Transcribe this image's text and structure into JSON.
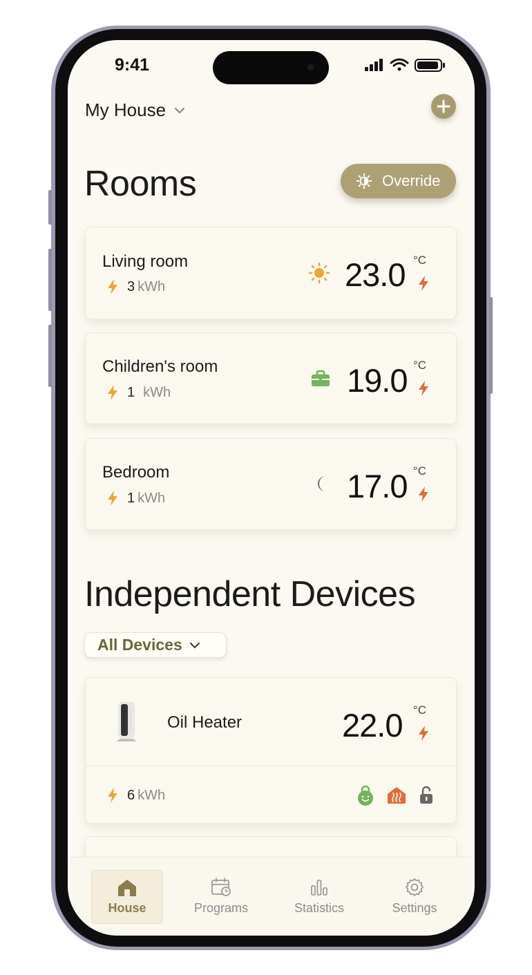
{
  "status_bar": {
    "time": "9:41"
  },
  "header": {
    "house_name": "My House"
  },
  "rooms_section": {
    "title": "Rooms",
    "override_label": "Override",
    "rooms": [
      {
        "name": "Living room",
        "kwh": "3",
        "kwh_unit": "kWh",
        "mode_icon": "sun-icon",
        "temperature": "23.0",
        "unit": "°C"
      },
      {
        "name": "Children's room",
        "kwh": "1",
        "kwh_unit": "kWh",
        "mode_icon": "briefcase-icon",
        "temperature": "19.0",
        "unit": "°C"
      },
      {
        "name": "Bedroom",
        "kwh": "1",
        "kwh_unit": "kWh",
        "mode_icon": "moon-icon",
        "temperature": "17.0",
        "unit": "°C"
      }
    ]
  },
  "devices_section": {
    "title": "Independent Devices",
    "filter_label": "All Devices",
    "devices": [
      {
        "name": "Oil Heater",
        "temperature": "22.0",
        "unit": "°C",
        "kwh": "6",
        "kwh_unit": "kWh",
        "status_icons": [
          "child-lock-icon",
          "heating-icon",
          "unlock-icon"
        ]
      }
    ]
  },
  "tabs": [
    {
      "label": "House",
      "icon": "house-icon",
      "active": true
    },
    {
      "label": "Programs",
      "icon": "calendar-icon",
      "active": false
    },
    {
      "label": "Statistics",
      "icon": "bar-chart-icon",
      "active": false
    },
    {
      "label": "Settings",
      "icon": "gear-icon",
      "active": false
    }
  ],
  "colors": {
    "accent": "#aea075",
    "energy_orange": "#e9a63a",
    "heat_red": "#e26b3a",
    "comfort_green": "#73b35b",
    "night_purple": "#7c5b79",
    "background": "#fbf9f2"
  }
}
